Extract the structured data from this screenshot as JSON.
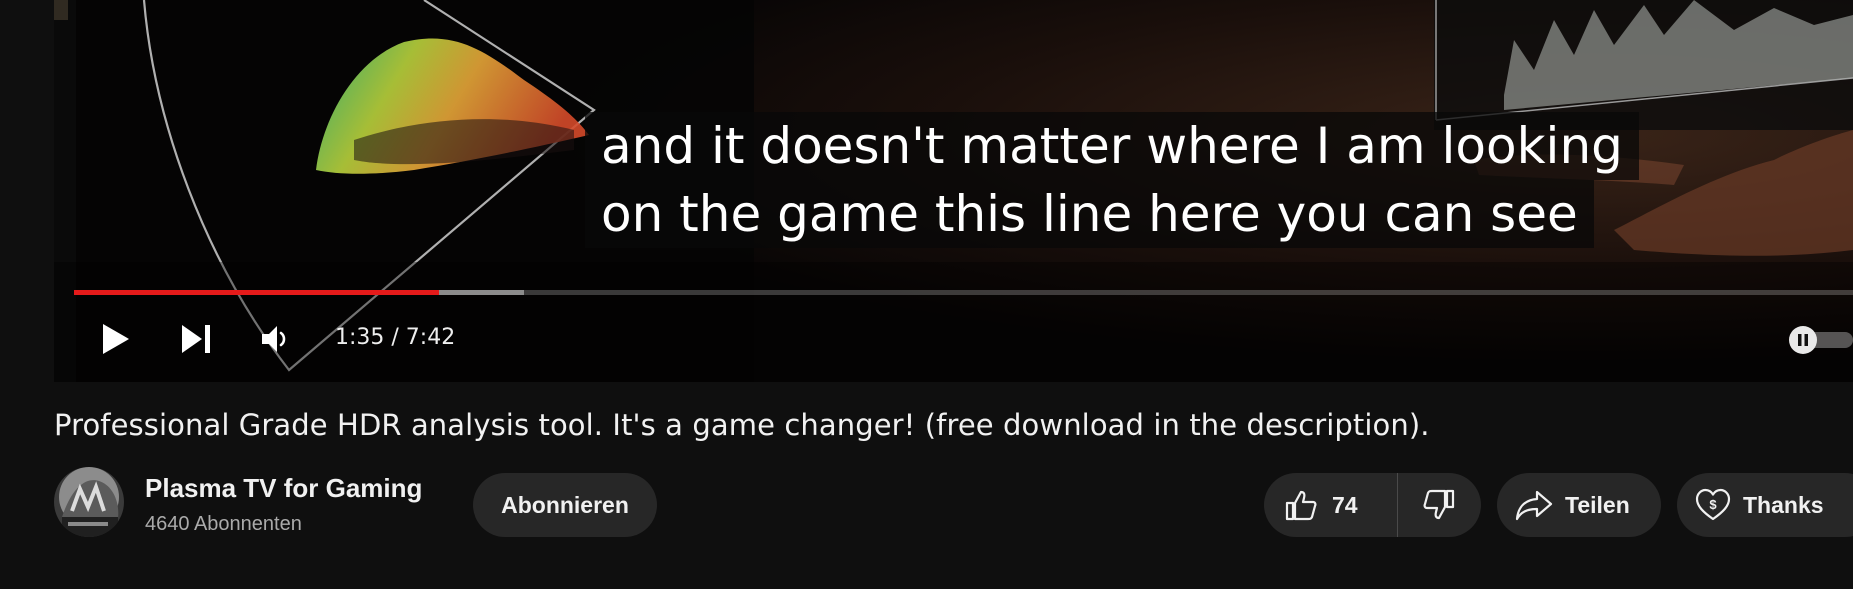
{
  "player": {
    "captions": [
      "and it doesn't matter where I am looking",
      "on the game this line here you can see"
    ],
    "time": {
      "current": "1:35",
      "separator": "/",
      "duration": "7:42",
      "display": "1:35 / 7:42"
    },
    "progress": {
      "played_fraction": 0.205,
      "buffered_fraction": 0.253
    },
    "buttons": {
      "play_icon": "play-icon",
      "next_icon": "next-icon",
      "volume_icon": "volume-icon",
      "autoplay_icon": "pause-icon"
    },
    "colors": {
      "progress": "#e41a1a"
    }
  },
  "video": {
    "title": "Professional Grade HDR analysis tool. It's a game changer! (free download in the description)."
  },
  "channel": {
    "name": "Plasma TV for Gaming",
    "subscribers": "4640 Abonnenten",
    "subscribe_label": "Abonnieren"
  },
  "actions": {
    "likes": "74",
    "share_label": "Teilen",
    "thanks_label": "Thanks",
    "icons": [
      "thumbs-up-icon",
      "thumbs-down-icon",
      "share-icon",
      "thanks-icon"
    ]
  }
}
